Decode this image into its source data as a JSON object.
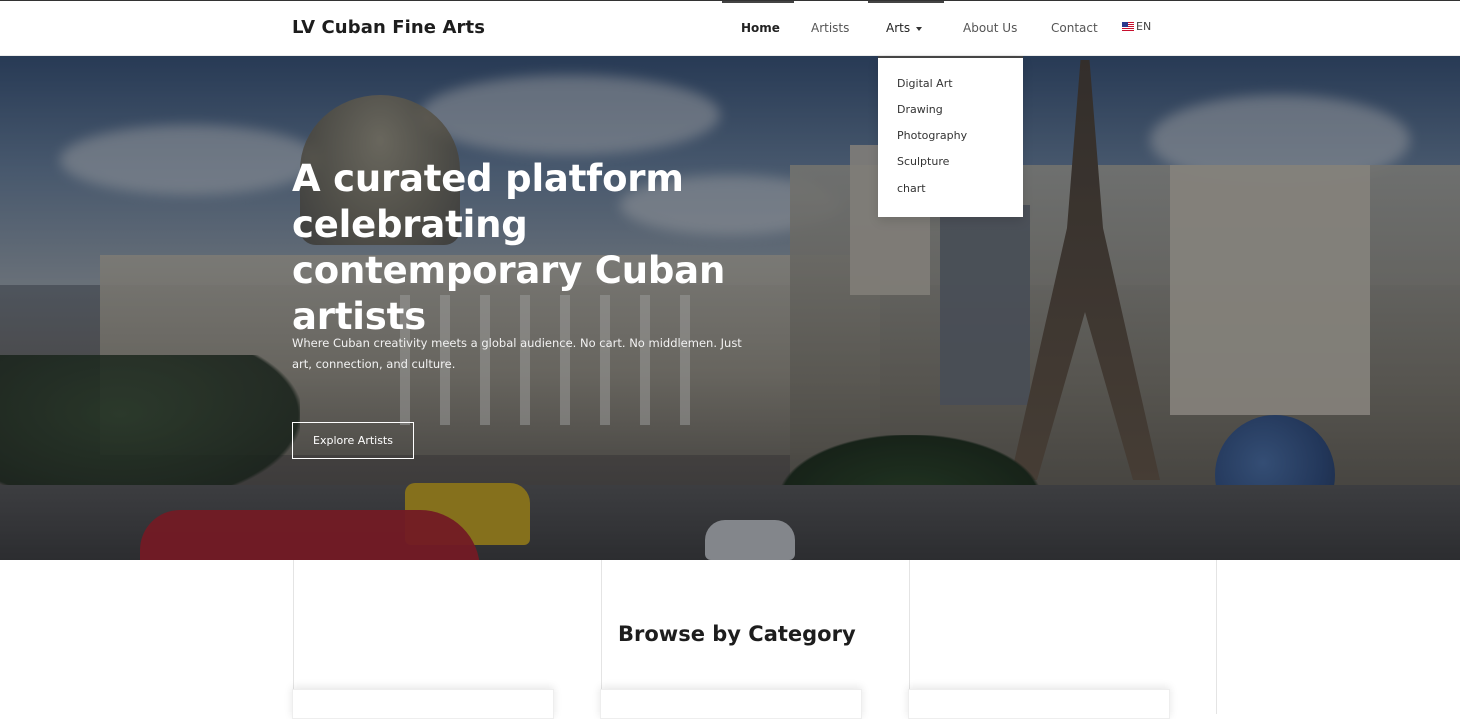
{
  "header": {
    "brand": "LV Cuban Fine Arts",
    "nav": {
      "home": "Home",
      "artists": "Artists",
      "arts": "Arts",
      "about": "About Us",
      "contact": "Contact"
    },
    "language": {
      "label": "EN",
      "flag_icon": "us-flag-icon"
    }
  },
  "arts_menu": {
    "items": [
      "Digital Art",
      "Drawing",
      "Photography",
      "Sculpture",
      "chart"
    ]
  },
  "hero": {
    "title": "A curated platform celebrating contemporary Cuban artists",
    "subtitle": "Where Cuban creativity meets a global audience. No cart. No middlemen. Just art, connection, and culture.",
    "cta": "Explore Artists"
  },
  "categories": {
    "title": "Browse by Category"
  },
  "colors": {
    "text_dark": "#1d1d1d",
    "hero_text": "#ffffff",
    "active_bar": "#444444"
  }
}
